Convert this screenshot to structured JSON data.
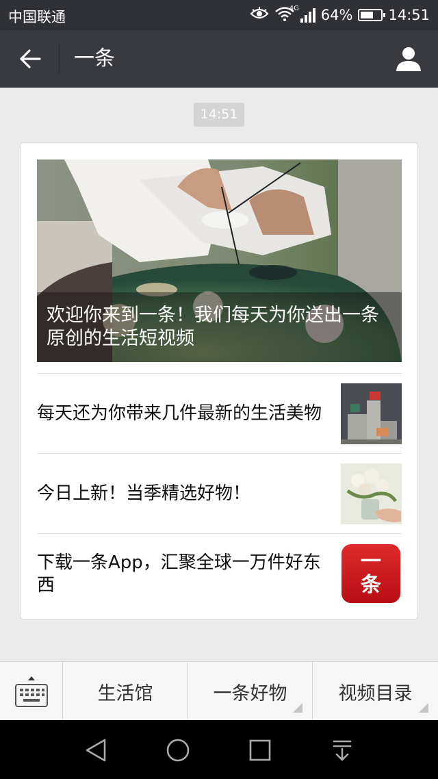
{
  "status_bar": {
    "carrier": "中国联通",
    "network_tag": "4G",
    "battery_text": "64%",
    "battery_level": 0.64,
    "time": "14:51",
    "icons": [
      "eye-icon",
      "wifi-icon",
      "signal-icon",
      "battery-icon"
    ]
  },
  "title_bar": {
    "title": "一条",
    "back_icon": "arrow-left-icon",
    "profile_icon": "person-icon"
  },
  "chat": {
    "timestamp": "14:51"
  },
  "article_card": {
    "hero_caption": "欢迎你来到一条！我们每天为你送出一条原创的生活短视频",
    "items": [
      {
        "text": "每天还为你带来几件最新的生活美物"
      },
      {
        "text": "今日上新！当季精选好物！"
      },
      {
        "text": "下载一条App，汇聚全球一万件好东西",
        "logo_text": "一条"
      }
    ]
  },
  "bottom_menu": {
    "keyboard_icon": "keyboard-icon",
    "items": [
      {
        "label": "生活馆"
      },
      {
        "label": "一条好物"
      },
      {
        "label": "视频目录"
      }
    ]
  },
  "nav_bar": {
    "icons": [
      "back-triangle-icon",
      "home-circle-icon",
      "recents-square-icon",
      "notification-down-icon"
    ]
  },
  "colors": {
    "title_bar": "#393a3f",
    "status_bar": "#2f3136",
    "background": "#ebebeb",
    "logo_red": "#d01c22"
  }
}
